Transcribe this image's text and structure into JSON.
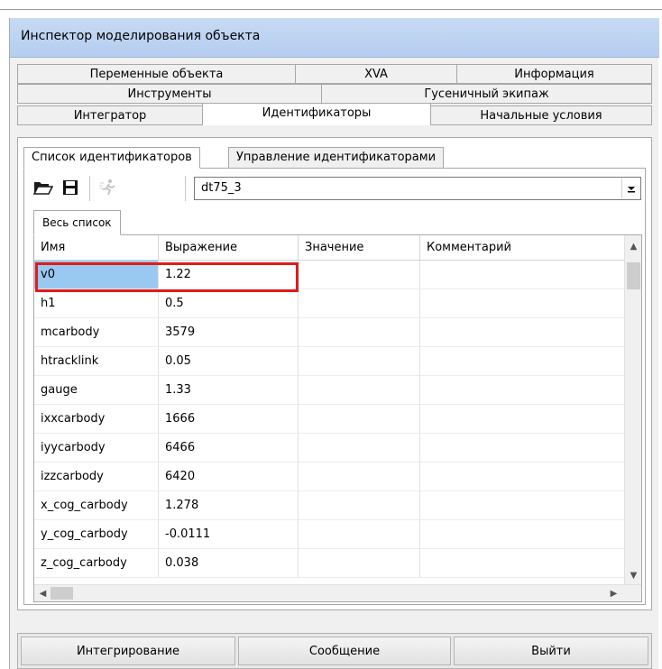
{
  "window": {
    "title": "Инспектор моделирования объекта"
  },
  "tabs": {
    "row1": [
      "Переменные объекта",
      "XVA",
      "Информация"
    ],
    "row2": [
      "Инструменты",
      "Гусеничный экипаж"
    ],
    "row3": [
      "Интегратор",
      "Идентификаторы",
      "Начальные условия"
    ],
    "selected": "Идентификаторы"
  },
  "subtabs": {
    "items": [
      "Список идентификаторов",
      "Управление идентификаторами"
    ],
    "selected": "Список идентификаторов"
  },
  "toolbar": {
    "icons": [
      "open-folder-icon",
      "save-icon",
      "run-icon"
    ],
    "combo_value": "dt75_3"
  },
  "inner_tab": {
    "label": "Весь список"
  },
  "table": {
    "columns": [
      "Имя",
      "Выражение",
      "Значение",
      "Комментарий"
    ],
    "rows": [
      {
        "name": "v0",
        "expression": "1.22",
        "value": "",
        "comment": ""
      },
      {
        "name": "h1",
        "expression": "0.5",
        "value": "",
        "comment": ""
      },
      {
        "name": "mcarbody",
        "expression": "3579",
        "value": "",
        "comment": ""
      },
      {
        "name": "htracklink",
        "expression": "0.05",
        "value": "",
        "comment": ""
      },
      {
        "name": "gauge",
        "expression": "1.33",
        "value": "",
        "comment": ""
      },
      {
        "name": "ixxcarbody",
        "expression": "1666",
        "value": "",
        "comment": ""
      },
      {
        "name": "iyycarbody",
        "expression": "6466",
        "value": "",
        "comment": ""
      },
      {
        "name": "izzcarbody",
        "expression": "6420",
        "value": "",
        "comment": ""
      },
      {
        "name": "x_cog_carbody",
        "expression": "1.278",
        "value": "",
        "comment": ""
      },
      {
        "name": "y_cog_carbody",
        "expression": "-0.0111",
        "value": "",
        "comment": ""
      },
      {
        "name": "z_cog_carbody",
        "expression": "0.038",
        "value": "",
        "comment": ""
      }
    ],
    "selected_row": 0
  },
  "footer": {
    "integrate_label": "Интегрирование",
    "message_label": "Сообщение",
    "exit_label": "Выйти"
  },
  "colors": {
    "selection": "#99c9f1",
    "highlight_border": "#e21b1b",
    "titlebar": "#c6daf3"
  }
}
